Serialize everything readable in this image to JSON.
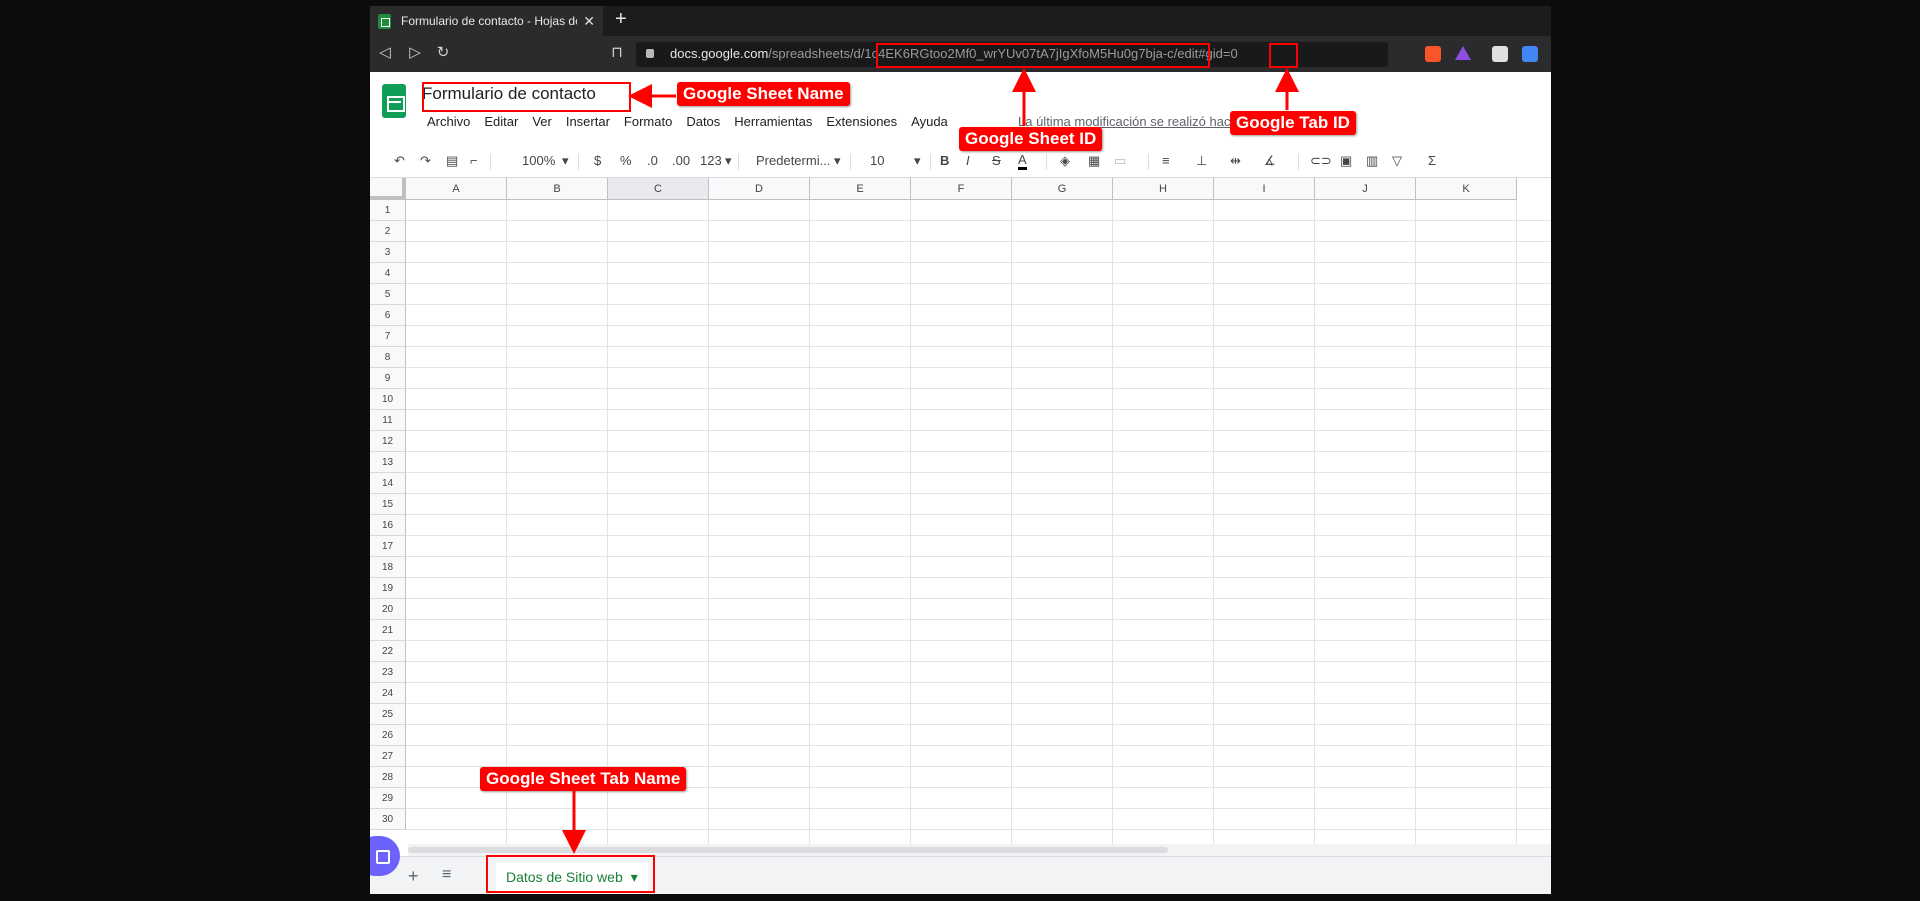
{
  "browser": {
    "tab_title": "Formulario de contacto - Hojas de cálculo de Google",
    "tab_close": "✕",
    "new_tab": "+",
    "url_host": "docs.google.com",
    "url_path_prefix": "/spreadsheets/d/",
    "url_sheet_id": "1c4EK6RGtoo2Mf0_wrYUv07tA7jIgXfoM5Hu0g7bja-c",
    "url_edit": "/edit#gid=",
    "url_gid": "0"
  },
  "sheets": {
    "doc_title": "Formulario de contacto",
    "menu": [
      "Archivo",
      "Editar",
      "Ver",
      "Insertar",
      "Formato",
      "Datos",
      "Herramientas",
      "Extensiones",
      "Ayuda"
    ],
    "last_modified": "La última modificación se realizó hace",
    "toolbar": {
      "zoom": "100%",
      "currency": "$",
      "percent": "%",
      "dec_less": ".0",
      "dec_more": ".00",
      "more_formats": "123",
      "font": "Predetermi...",
      "font_size": "10",
      "bold": "B",
      "italic": "I",
      "strike": "S",
      "text_color": "A"
    },
    "columns": [
      "A",
      "B",
      "C",
      "D",
      "E",
      "F",
      "G",
      "H",
      "I",
      "J",
      "K"
    ],
    "selected_column": "C",
    "rows": [
      "1",
      "2",
      "3",
      "4",
      "5",
      "6",
      "7",
      "8",
      "9",
      "10",
      "11",
      "12",
      "13",
      "14",
      "15",
      "16",
      "17",
      "18",
      "19",
      "20",
      "21",
      "22",
      "23",
      "24",
      "25",
      "26",
      "27",
      "28",
      "29",
      "30"
    ],
    "sheet_tab": "Datos de Sitio web",
    "add_sheet": "+",
    "all_sheets": "≡"
  },
  "annotations": {
    "sheet_name": "Google Sheet Name",
    "sheet_id": "Google Sheet ID",
    "tab_id": "Google Tab ID",
    "tab_name": "Google Sheet Tab Name"
  },
  "colors": {
    "annotation_red": "#ff0000",
    "sheets_green": "#0f9d58",
    "tab_text_green": "#188038"
  }
}
